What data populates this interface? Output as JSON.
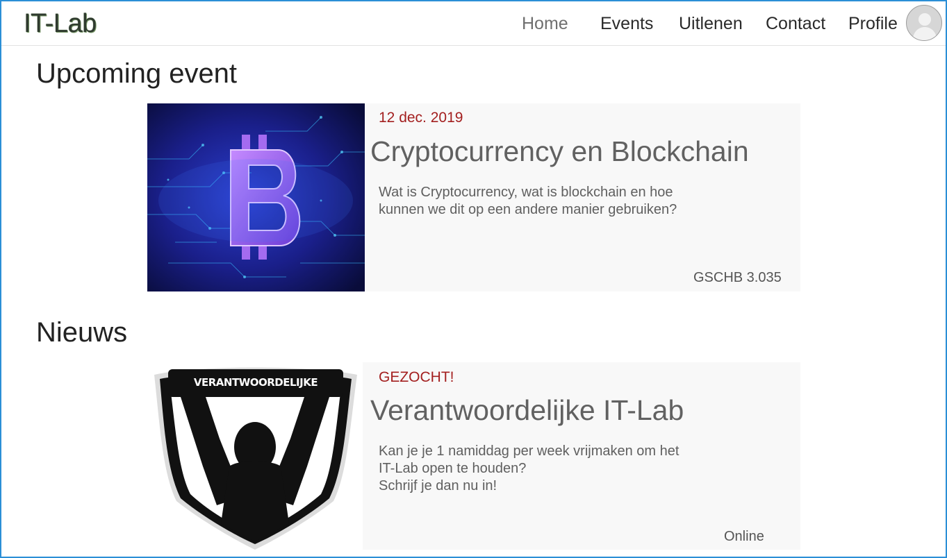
{
  "header": {
    "brand": "IT-Lab",
    "nav": {
      "home": "Home",
      "events": "Events",
      "uitlenen": "Uitlenen",
      "contact": "Contact",
      "profile": "Profile"
    }
  },
  "upcoming": {
    "section_title": "Upcoming event",
    "date": "12 dec. 2019",
    "title": "Cryptocurrency en Blockchain",
    "description": "Wat is Cryptocurrency, wat is blockchain en hoe kunnen we dit op een andere manier gebruiken?",
    "location": "GSCHB 3.035"
  },
  "news": {
    "section_title": "Nieuws",
    "badge_text": "VERANTWOORDELIJKE",
    "tag": "GEZOCHT!",
    "title": "Verantwoordelijke IT-Lab",
    "description_line1": "Kan je je 1 namiddag per week vrijmaken om het",
    "description_line2": "IT-Lab open te houden?",
    "description_line3": "Schrijf je dan nu in!",
    "location": "Online"
  },
  "colors": {
    "accent_red": "#a31f1f",
    "frame_blue": "#2b8fd6"
  },
  "icons": {
    "avatar": "user-avatar-icon",
    "event_image": "bitcoin-icon",
    "news_image": "scarf-fan-shield-icon"
  }
}
